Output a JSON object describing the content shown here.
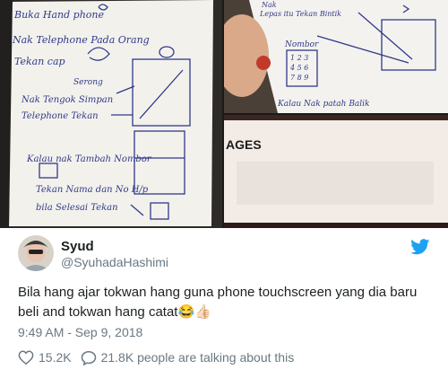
{
  "tweet": {
    "display_name": "Syud",
    "handle": "@SyuhadaHashimi",
    "text": "Bila hang ajar tokwan hang guna phone touchscreen yang dia baru beli and tokwan hang catat",
    "emoji": "😂👍🏻",
    "timestamp": "9:49 AM - Sep 9, 2018",
    "likes": "15.2K",
    "talking": "21.8K people are talking about this"
  },
  "note_left": {
    "lines": [
      "Buka Hand phone",
      "Nak Telephone Pada Orang",
      "Tekan cap",
      "Serong",
      "Nak Tengok Simpan",
      "Telephone Tekan",
      "Kalau nak Tambah Nombor",
      "Tekan Nama dan No H/p",
      "bila Selesai Tekan"
    ]
  },
  "note_right": {
    "lines": [
      "Nak",
      "Lepas itu Tekan Bintik",
      "Nombor",
      "Kalau Nak patah Balik"
    ],
    "keypad": [
      "1 2 3",
      "4 5 6",
      "7 8 9"
    ]
  },
  "screen_text": "AGES",
  "colors": {
    "twitter_blue": "#1da1f2",
    "text_primary": "#1c2022",
    "text_secondary": "#697882",
    "ink": "#2f3a8a"
  },
  "icons": {
    "brand": "twitter-bird-icon",
    "like": "heart-outline-icon",
    "talk": "speech-bubble-icon"
  }
}
